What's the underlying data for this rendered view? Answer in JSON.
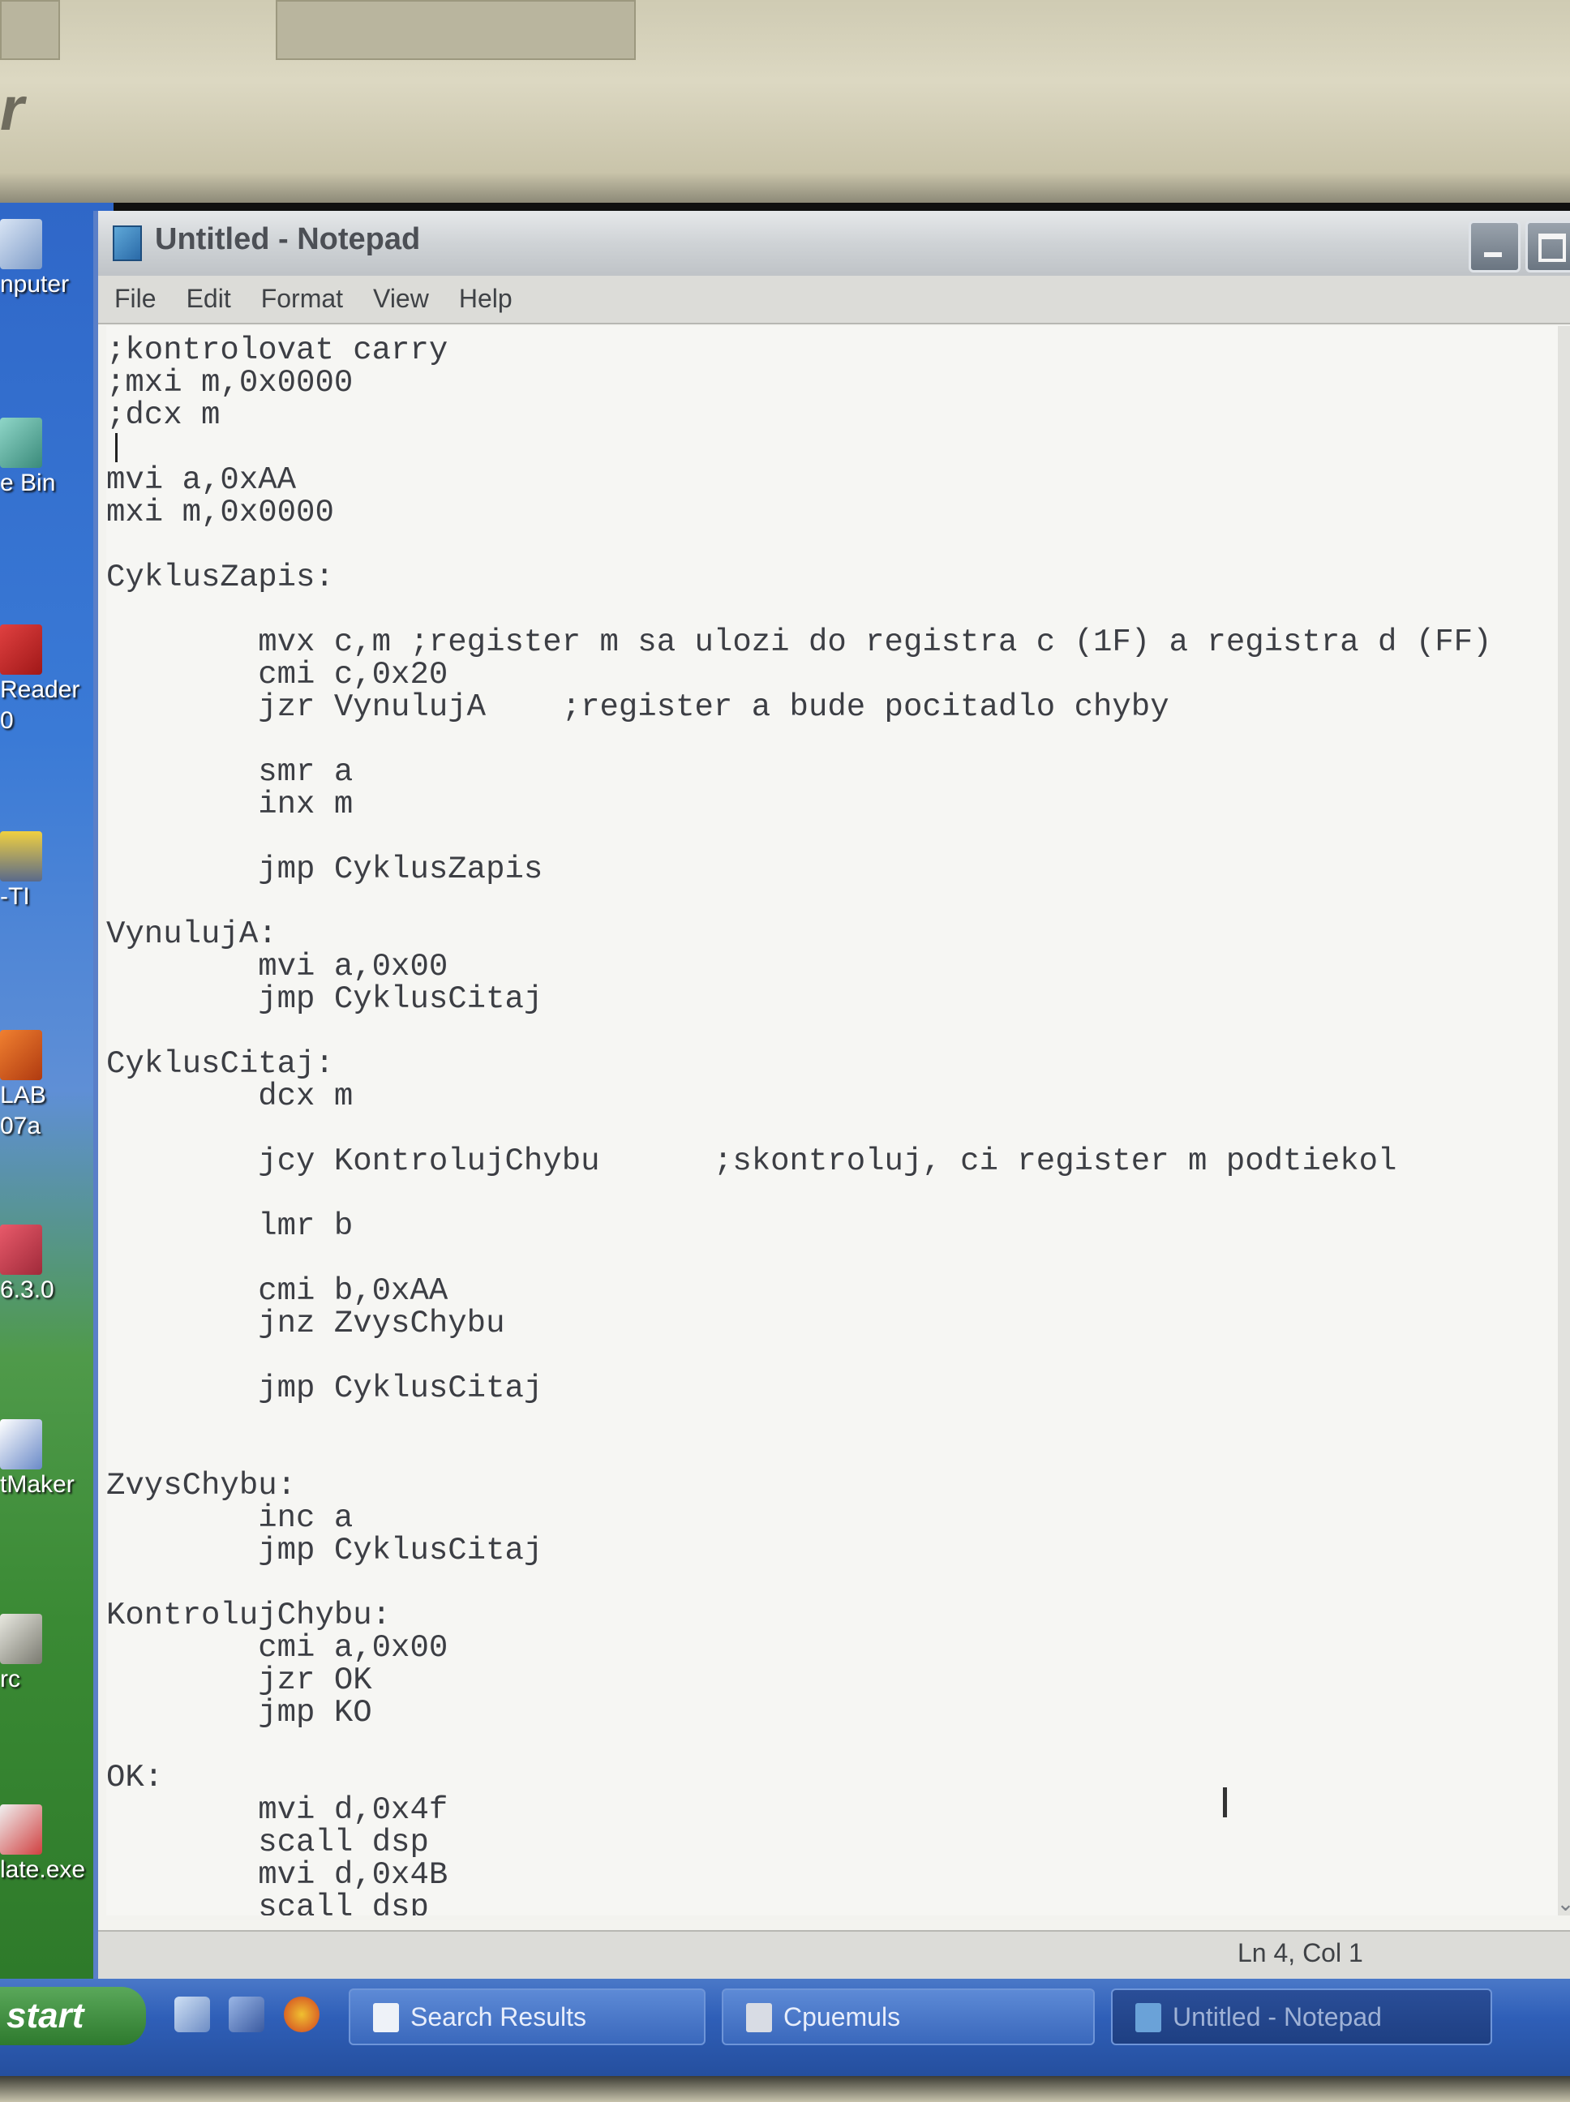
{
  "window": {
    "title": "Untitled - Notepad"
  },
  "menu": [
    "File",
    "Edit",
    "Format",
    "View",
    "Help"
  ],
  "editor": {
    "lines": [
      ";kontrolovat carry",
      ";mxi m,0x0000",
      ";dcx m",
      "",
      "mvi a,0xAA",
      "mxi m,0x0000",
      "",
      "CyklusZapis:",
      "",
      "        mvx c,m ;register m sa ulozi do registra c (1F) a registra d (FF)",
      "        cmi c,0x20",
      "        jzr VynulujA    ;register a bude pocitadlo chyby",
      "",
      "        smr a",
      "        inx m",
      "",
      "        jmp CyklusZapis",
      "",
      "VynulujA:",
      "        mvi a,0x00",
      "        jmp CyklusCitaj",
      "",
      "CyklusCitaj:",
      "        dcx m",
      "",
      "        jcy KontrolujChybu      ;skontroluj, ci register m podtiekol",
      "",
      "        lmr b",
      "",
      "        cmi b,0xAA",
      "        jnz ZvysChybu",
      "",
      "        jmp CyklusCitaj",
      "",
      "",
      "ZvysChybu:",
      "        inc a",
      "        jmp CyklusCitaj",
      "",
      "KontrolujChybu:",
      "        cmi a,0x00",
      "        jzr OK",
      "        jmp KO",
      "",
      "OK:",
      "        mvi d,0x4f",
      "        scall dsp",
      "        mvi d,0x4B",
      "        scall dsp"
    ]
  },
  "status": {
    "position": "Ln 4, Col 1"
  },
  "desktop": {
    "icons": [
      {
        "label": "nputer",
        "icon": "computer-icon"
      },
      {
        "label": "e Bin",
        "icon": "recycle-bin-icon"
      },
      {
        "label": "Reader\n0",
        "icon": "adobe-reader-icon"
      },
      {
        "label": "-TI",
        "icon": "calculator-icon"
      },
      {
        "label": "LAB\n07a",
        "icon": "matlab-icon"
      },
      {
        "label": "6.3.0",
        "icon": "app-icon"
      },
      {
        "label": "tMaker",
        "icon": "diagram-tool-icon"
      },
      {
        "label": "rc",
        "icon": "settings-app-icon"
      },
      {
        "label": "late.exe",
        "icon": "exe-file-icon"
      }
    ]
  },
  "taskbar": {
    "start_label": "start",
    "tasks": [
      {
        "label": "Search Results",
        "icon": "search-folder-icon"
      },
      {
        "label": "Cpuemuls",
        "icon": "emulator-icon"
      },
      {
        "label": "Untitled - Notepad",
        "icon": "notepad-icon"
      }
    ]
  },
  "colors": {
    "title_text": "#4c4f55",
    "editor_text": "#3c3e44",
    "taskbar_blue": "#2f5fb8",
    "start_green": "#3a8a3a"
  }
}
